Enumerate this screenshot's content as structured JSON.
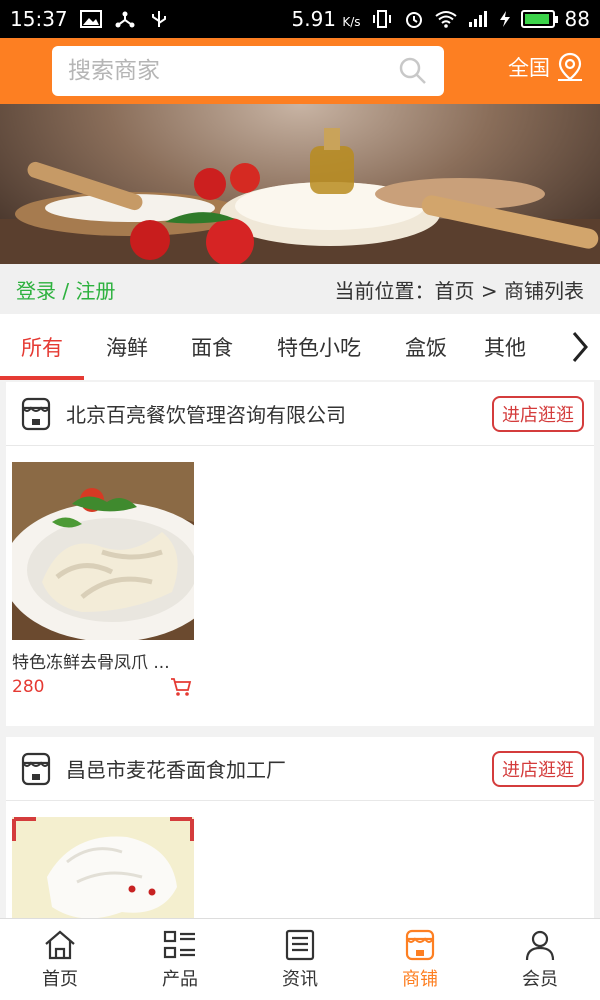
{
  "status_bar": {
    "time": "15:37",
    "network_speed": "5.91",
    "speed_unit": "K/s",
    "battery": "88"
  },
  "search": {
    "placeholder": "搜索商家"
  },
  "region": {
    "label": "全国"
  },
  "breadcrumb": {
    "login_label": "登录 / 注册",
    "path": "当前位置：首页 > 商铺列表"
  },
  "tabs": [
    {
      "label": "所有",
      "active": true
    },
    {
      "label": "海鲜"
    },
    {
      "label": "面食"
    },
    {
      "label": "特色小吃"
    },
    {
      "label": "盒饭"
    },
    {
      "label": "其他"
    }
  ],
  "stores": [
    {
      "name": "北京百亮餐饮管理咨询有限公司",
      "visit_label": "进店逛逛",
      "products": [
        {
          "title": "特色冻鲜去骨凤爪 ...",
          "price": "280"
        }
      ]
    },
    {
      "name": "昌邑市麦花香面食加工厂",
      "visit_label": "进店逛逛",
      "products": []
    }
  ],
  "bottom_nav": [
    {
      "label": "首页",
      "icon": "home-icon"
    },
    {
      "label": "产品",
      "icon": "grid-list-icon"
    },
    {
      "label": "资讯",
      "icon": "news-icon"
    },
    {
      "label": "商铺",
      "icon": "store-icon",
      "active": true
    },
    {
      "label": "会员",
      "icon": "user-icon"
    }
  ],
  "colors": {
    "header": "#fd7f22",
    "accent_red": "#e53a33",
    "login_green": "#2db13e",
    "nav_active": "#fd7f22"
  }
}
